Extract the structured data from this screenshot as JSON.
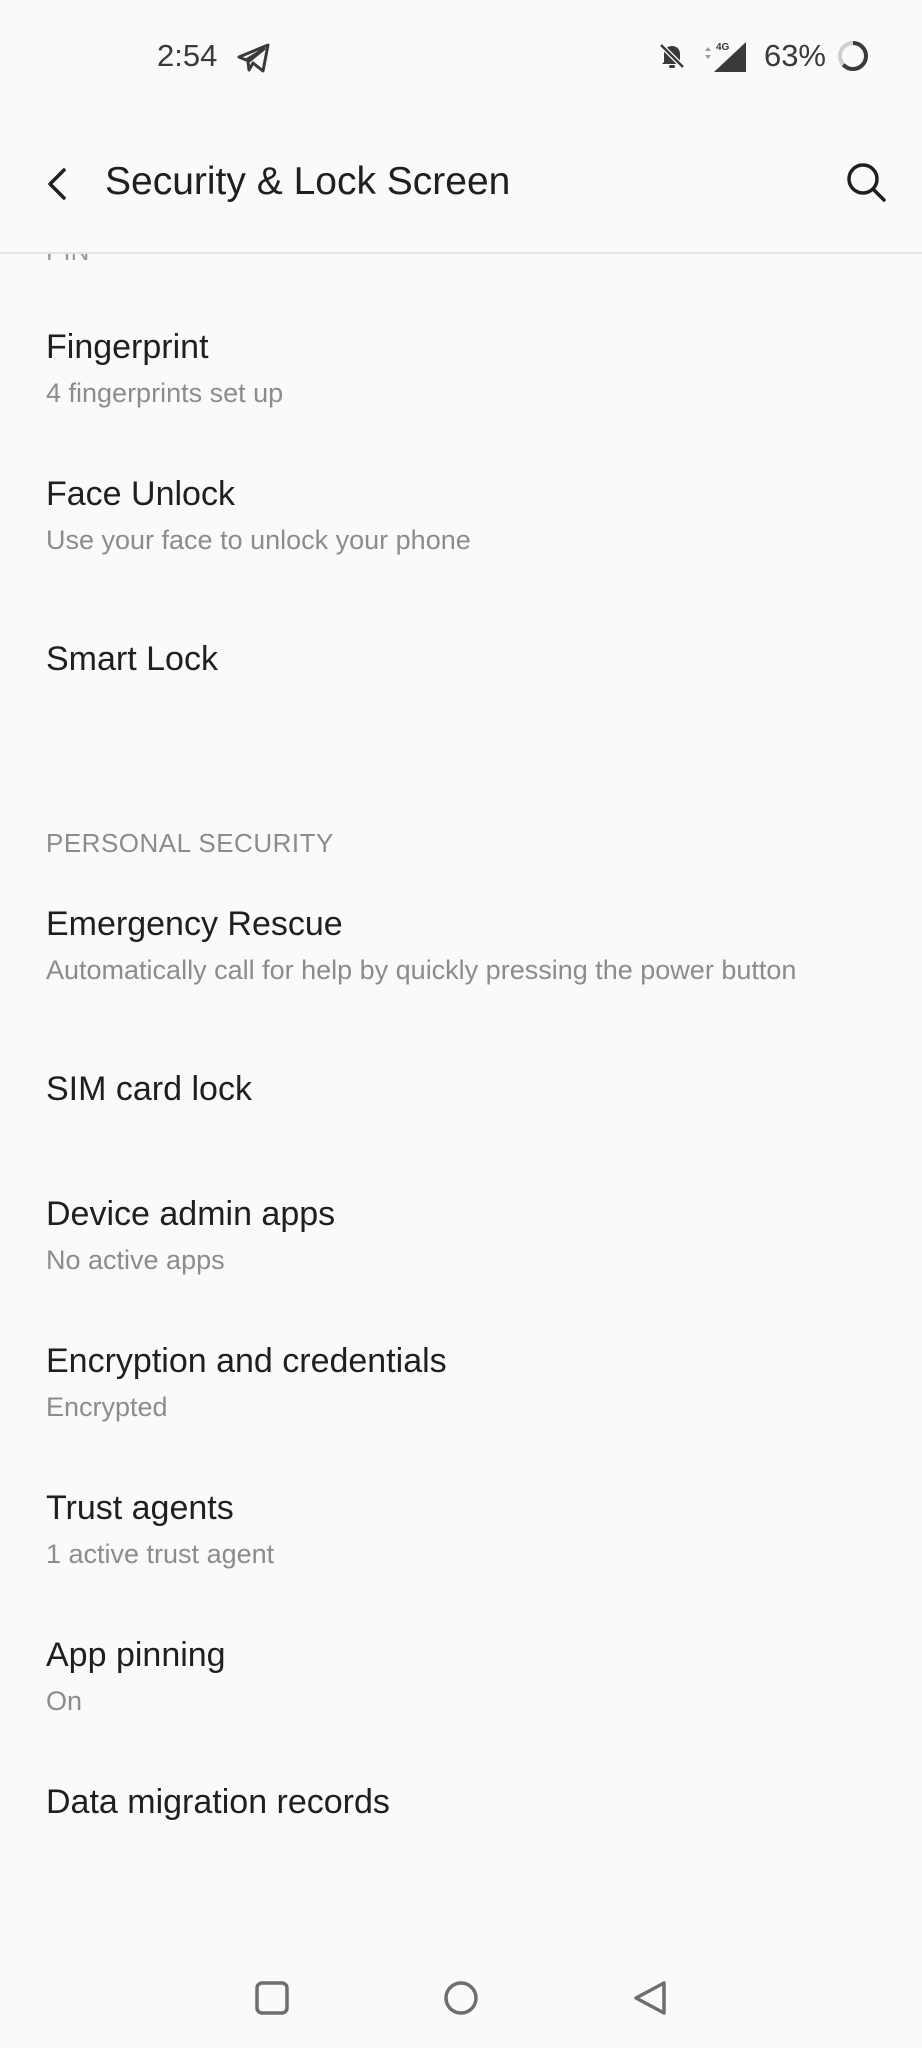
{
  "status_bar": {
    "time": "2:54",
    "battery_percent": "63%",
    "network_type": "4G",
    "battery_level": 0.63,
    "icons": [
      "telegram-icon",
      "notifications-off-icon",
      "signal-4g-icon",
      "battery-ring-icon"
    ]
  },
  "app_bar": {
    "title": "Security & Lock Screen",
    "back_icon": "back-arrow-icon",
    "search_icon": "search-icon"
  },
  "clipped_item_label": "PIN",
  "items": [
    {
      "title": "Fingerprint",
      "subtitle": "4 fingerprints set up"
    },
    {
      "title": "Face Unlock",
      "subtitle": "Use your face to unlock your phone"
    },
    {
      "title": "Smart Lock",
      "subtitle": ""
    }
  ],
  "section_personal": {
    "header": "PERSONAL SECURITY",
    "items": [
      {
        "title": "Emergency Rescue",
        "subtitle": "Automatically call for help by quickly pressing the power button"
      },
      {
        "title": "SIM card lock",
        "subtitle": ""
      },
      {
        "title": "Device admin apps",
        "subtitle": "No active apps"
      },
      {
        "title": "Encryption and credentials",
        "subtitle": "Encrypted"
      },
      {
        "title": "Trust agents",
        "subtitle": "1 active trust agent"
      },
      {
        "title": "App pinning",
        "subtitle": "On"
      },
      {
        "title": "Data migration records",
        "subtitle": ""
      }
    ]
  },
  "nav_bar": {
    "icons": [
      "recents-square-icon",
      "home-circle-icon",
      "back-triangle-icon"
    ]
  },
  "colors": {
    "background": "#fafafa",
    "primary_text": "#1f1f1f",
    "secondary_text": "#8c8c8c",
    "divider": "#e4e4e4"
  }
}
